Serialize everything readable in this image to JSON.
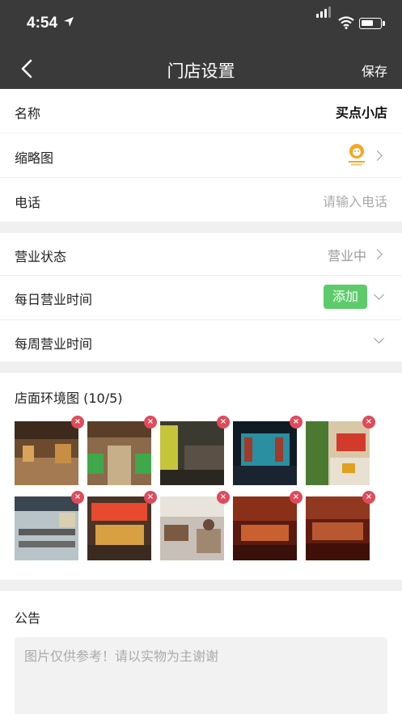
{
  "status": {
    "time": "4:54"
  },
  "nav": {
    "title": "门店设置",
    "save": "保存"
  },
  "basic": {
    "name_label": "名称",
    "name_value": "买点小店",
    "thumb_label": "缩略图",
    "phone_label": "电话",
    "phone_placeholder": "请输入电话"
  },
  "business": {
    "status_label": "营业状态",
    "status_value": "营业中",
    "daily_label": "每日营业时间",
    "add_label": "添加",
    "weekly_label": "每周营业时间"
  },
  "gallery": {
    "title": "店面环境图 (10/5)",
    "images": [
      {
        "name": "store-photo-1"
      },
      {
        "name": "store-photo-2"
      },
      {
        "name": "store-photo-3"
      },
      {
        "name": "store-photo-4"
      },
      {
        "name": "store-photo-5"
      },
      {
        "name": "store-photo-6"
      },
      {
        "name": "store-photo-7"
      },
      {
        "name": "store-photo-8"
      },
      {
        "name": "store-photo-9"
      },
      {
        "name": "store-photo-10"
      }
    ]
  },
  "notice": {
    "title": "公告",
    "content": "图片仅供参考！请以实物为主谢谢"
  },
  "colors": {
    "nav_bg": "#3a3a3a",
    "accent_green": "#5ccb6a",
    "delete_red": "#e04a5a",
    "logo_orange": "#f5a623"
  }
}
